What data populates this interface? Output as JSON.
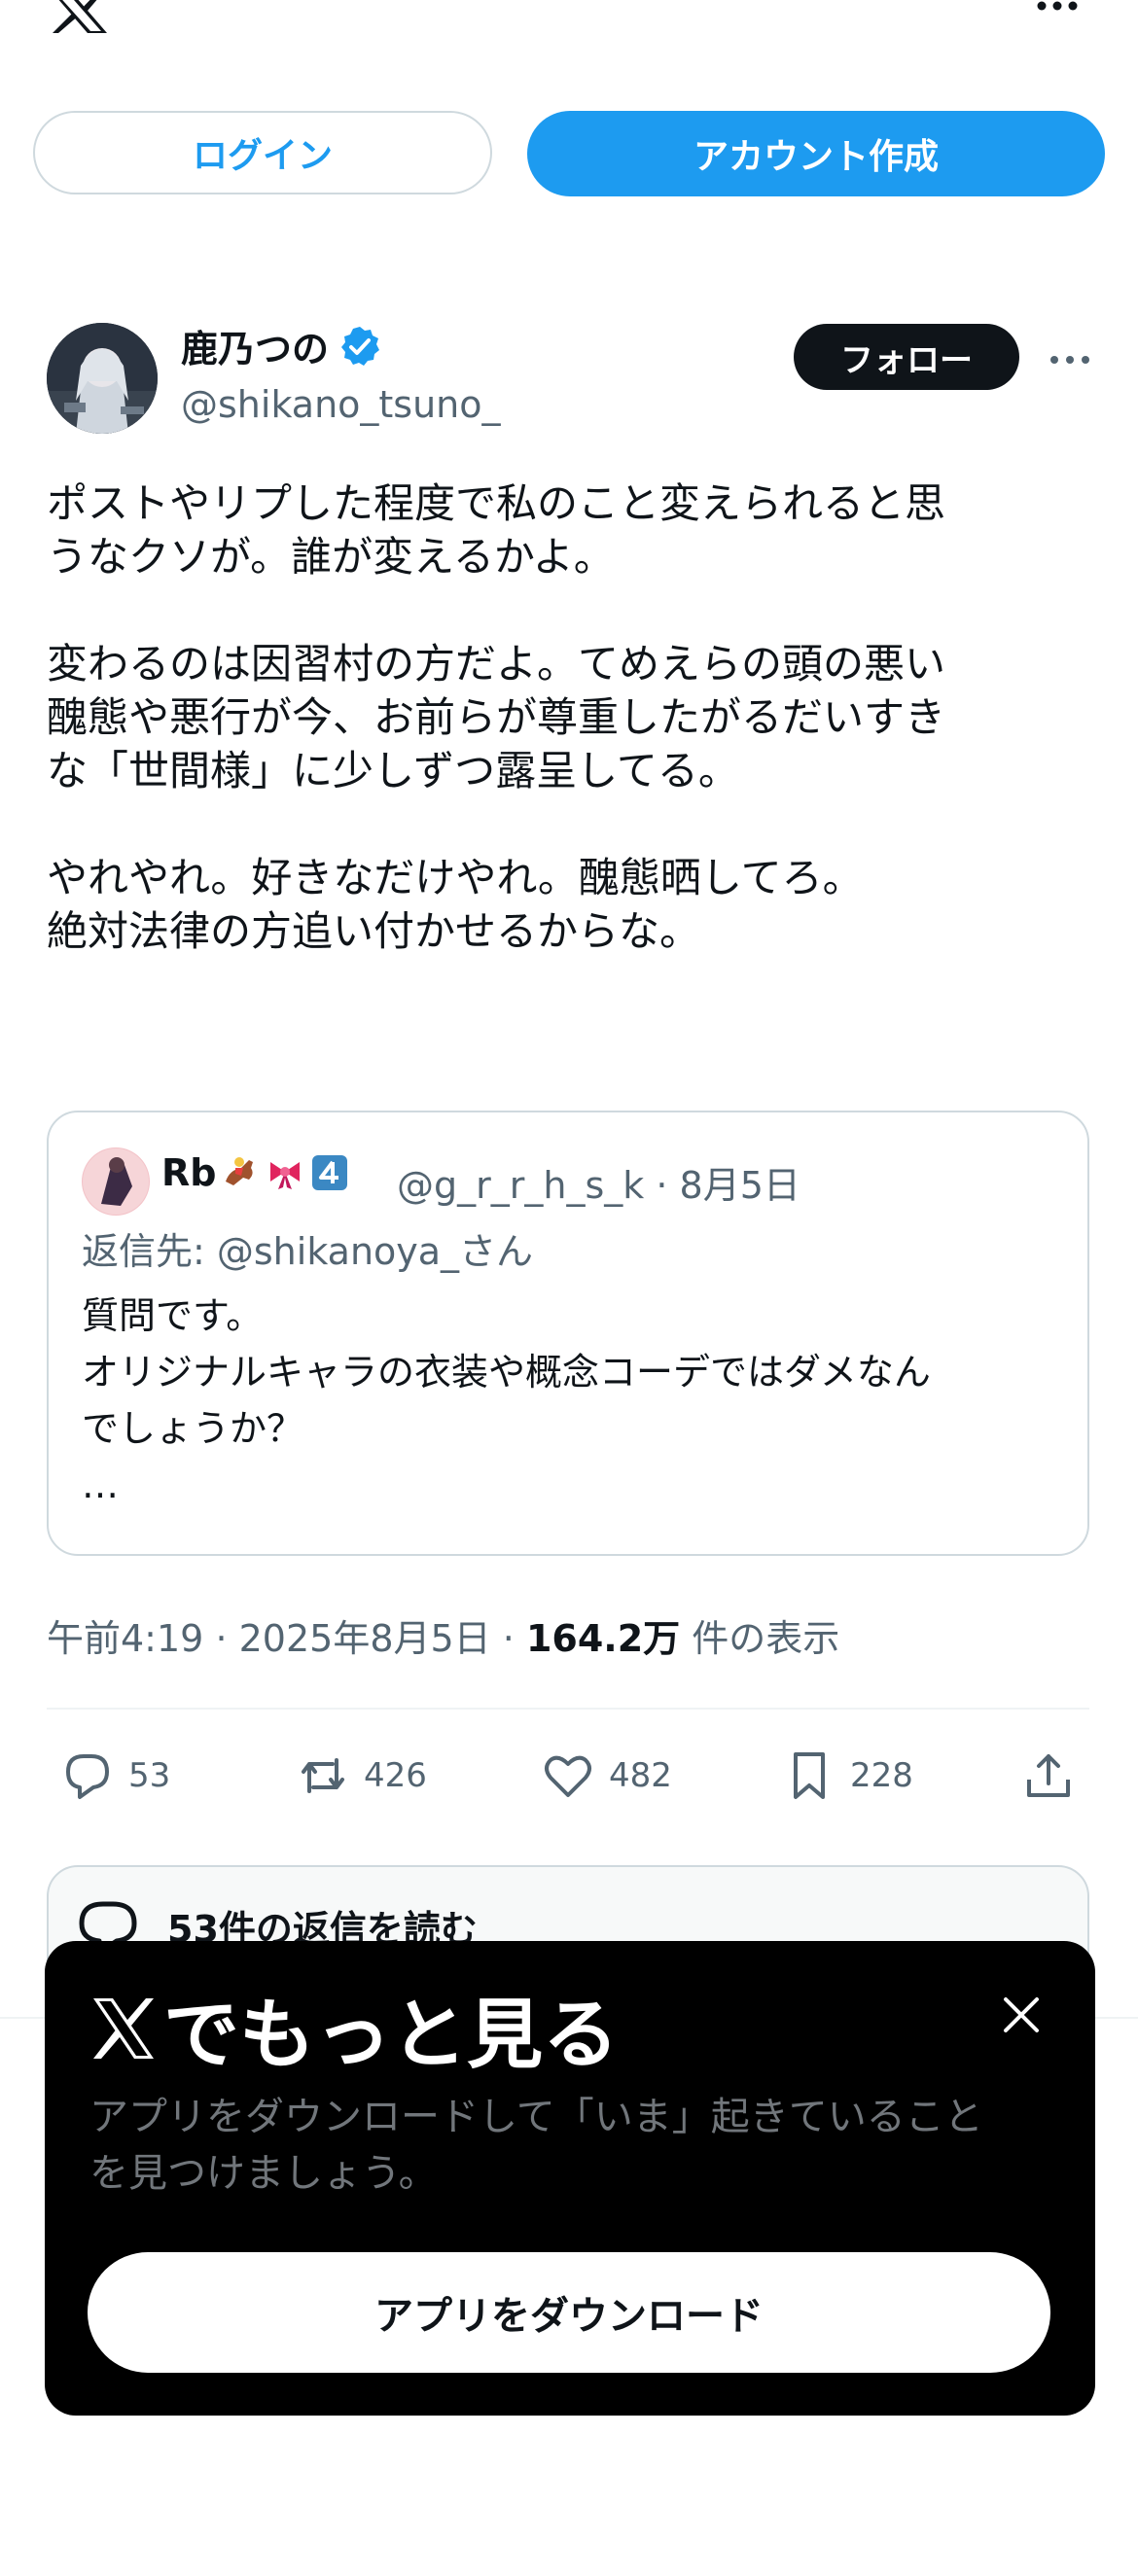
{
  "header": {
    "login_label": "ログイン",
    "create_account_label": "アカウント作成"
  },
  "post": {
    "author_name": "鹿乃つの",
    "author_handle": "@shikano_tsuno_",
    "follow_label": "フォロー",
    "paragraphs": [
      [
        "ポストやリプした程度で私のこと変えられると思",
        "うなクソが。誰が変えるかよ。"
      ],
      [
        "変わるのは因習村の方だよ。てめえらの頭の悪い",
        "醜態や悪行が今、お前らが尊重したがるだいすき",
        "な「世間様」に少しずつ露呈してる。"
      ],
      [
        "やれやれ。好きなだけやれ。醜態晒してろ。",
        "絶対法律の方追い付かせるからな。"
      ]
    ],
    "time": "午前4:19",
    "date": "2025年8月5日",
    "views_count": "164.2万",
    "views_label": "件の表示",
    "separator": "·"
  },
  "quote": {
    "name": "Rb",
    "handle": "@g_r_r_h_s_k",
    "date": "8月5日",
    "separator": "·",
    "reply_to": "返信先: @shikanoya_さん",
    "lines": [
      "質問です。",
      "オリジナルキャラの衣装や概念コーデではダメなん",
      "でしょうか？",
      "…"
    ]
  },
  "actions": {
    "replies": "53",
    "reposts": "426",
    "likes": "482",
    "bookmarks": "228"
  },
  "read_replies_label": "53件の返信を読む",
  "sheet": {
    "title": "でもっと見る",
    "desc_lines": [
      "アプリをダウンロードして「いま」起きていること",
      "を見つけましょう。"
    ],
    "download_label": "アプリをダウンロード"
  },
  "colors": {
    "accent": "#1d9bf0",
    "text": "#0f1419",
    "muted": "#536471",
    "border": "#cfd9de"
  }
}
